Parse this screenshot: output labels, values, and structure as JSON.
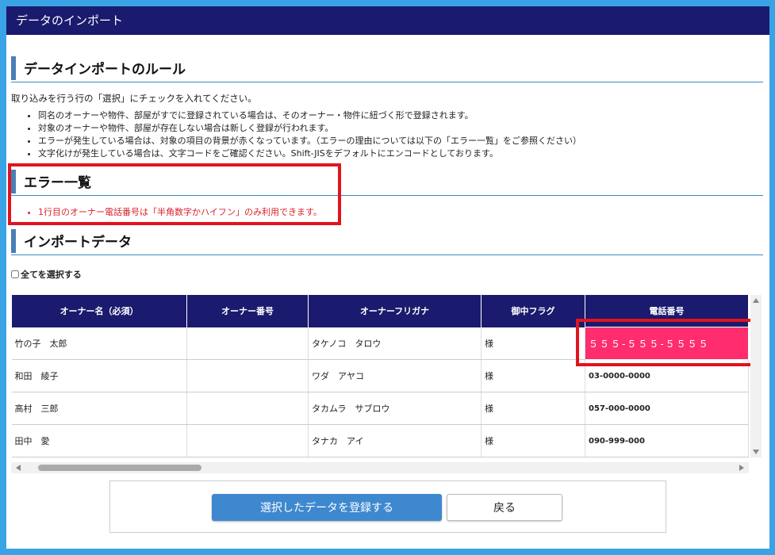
{
  "window": {
    "title": "データのインポート"
  },
  "rules": {
    "heading": "データインポートのルール",
    "intro": "取り込みを行う行の「選択」にチェックを入れてください。",
    "items": [
      "同名のオーナーや物件、部屋がすでに登録されている場合は、そのオーナー・物件に紐づく形で登録されます。",
      "対象のオーナーや物件、部屋が存在しない場合は新しく登録が行われます。",
      "エラーが発生している場合は、対象の項目の背景が赤くなっています。（エラーの理由については以下の「エラー一覧」をご参照ください）",
      "文字化けが発生している場合は、文字コードをご確認ください。Shift-JISをデフォルトにエンコードとしております。"
    ]
  },
  "errors": {
    "heading": "エラー一覧",
    "items": [
      "1行目のオーナー電話番号は「半角数字かハイフン」のみ利用できます。"
    ]
  },
  "import": {
    "heading": "インポートデータ",
    "select_all_label": "全てを選択する",
    "columns": [
      "オーナー名（必須）",
      "オーナー番号",
      "オーナーフリガナ",
      "御中フラグ",
      "電話番号"
    ],
    "rows": [
      {
        "name": "竹の子　太郎",
        "number": "",
        "kana": "タケノコ　タロウ",
        "flag": "様",
        "phone": "５５５-５５５-５５５５"
      },
      {
        "name": "和田　綾子",
        "number": "",
        "kana": "ワダ　アヤコ",
        "flag": "様",
        "phone": "03-0000-0000"
      },
      {
        "name": "高村　三郎",
        "number": "",
        "kana": "タカムラ　サブロウ",
        "flag": "様",
        "phone": "057-000-0000"
      },
      {
        "name": "田中　愛",
        "number": "",
        "kana": "タナカ　アイ",
        "flag": "様",
        "phone": "090-999-000"
      }
    ]
  },
  "buttons": {
    "register": "選択したデータを登録する",
    "back": "戻る"
  },
  "colors": {
    "header_bg": "#1a1a6e",
    "error_cell": "#ff2d6e",
    "annotation": "#e0141f",
    "primary_button": "#3e88cf",
    "frame": "#3aa3e6"
  }
}
